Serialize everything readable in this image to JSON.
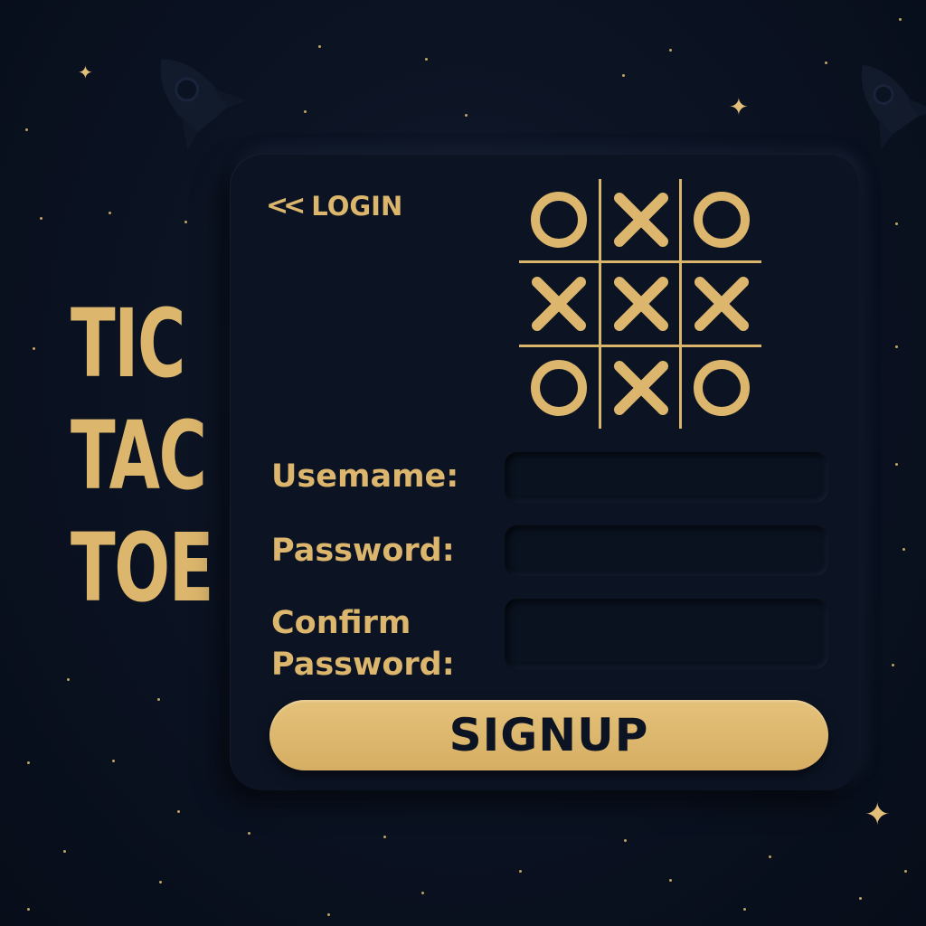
{
  "title": {
    "line1": "TIC",
    "line2": "TAC",
    "line3": "TOE"
  },
  "nav": {
    "back_chevron": "<<",
    "login_label": "LOGIN"
  },
  "board": {
    "cells": [
      "O",
      "X",
      "O",
      "X",
      "X",
      "X",
      "O",
      "X",
      "O"
    ]
  },
  "form": {
    "username_label": "Usemame:",
    "password_label": "Password:",
    "confirm_label_line1": "Confirm",
    "confirm_label_line2": "Password:",
    "username_value": "",
    "password_value": "",
    "confirm_value": "",
    "signup_label": "SIGNUP"
  },
  "colors": {
    "background": "#0b1220",
    "panel": "#0c1424",
    "accent_gold": "#dcb66c",
    "button_gold": "#e0bc74"
  }
}
